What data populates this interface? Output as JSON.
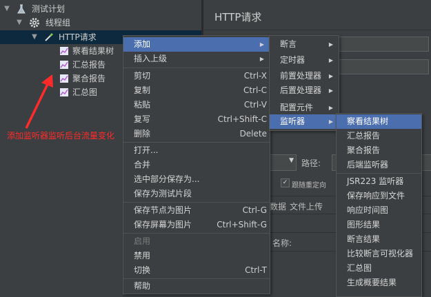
{
  "tree": {
    "items": [
      {
        "label": "测试计划"
      },
      {
        "label": "线程组"
      },
      {
        "label": "HTTP请求"
      },
      {
        "label": "察看结果树"
      },
      {
        "label": "汇总报告"
      },
      {
        "label": "聚合报告"
      },
      {
        "label": "汇总图"
      }
    ],
    "annotation": "添加监听器监听后台流量变化"
  },
  "right_panel": {
    "title": "HTTP请求",
    "path_label": "路径:",
    "follow_redirects": "跟随重定向",
    "tab_data": "数据",
    "tab_file_upload": "文件上传",
    "name_label": "名称:"
  },
  "context_menu": {
    "items": [
      {
        "label": "添加"
      },
      {
        "label": "插入上级"
      },
      {
        "label": "剪切",
        "shortcut": "Ctrl-X"
      },
      {
        "label": "复制",
        "shortcut": "Ctrl-C"
      },
      {
        "label": "粘贴",
        "shortcut": "Ctrl-V"
      },
      {
        "label": "复写",
        "shortcut": "Ctrl+Shift-C"
      },
      {
        "label": "删除",
        "shortcut": "Delete"
      },
      {
        "label": "打开..."
      },
      {
        "label": "合并"
      },
      {
        "label": "选中部分保存为..."
      },
      {
        "label": "保存为测试片段"
      },
      {
        "label": "保存节点为图片",
        "shortcut": "Ctrl-G"
      },
      {
        "label": "保存屏幕为图片",
        "shortcut": "Ctrl+Shift-G"
      },
      {
        "label": "启用"
      },
      {
        "label": "禁用"
      },
      {
        "label": "切换",
        "shortcut": "Ctrl-T"
      },
      {
        "label": "帮助"
      }
    ]
  },
  "add_submenu": {
    "items": [
      {
        "label": "断言"
      },
      {
        "label": "定时器"
      },
      {
        "label": "前置处理器"
      },
      {
        "label": "后置处理器"
      },
      {
        "label": "配置元件"
      },
      {
        "label": "监听器"
      }
    ]
  },
  "listener_submenu": {
    "items": [
      {
        "label": "察看结果树"
      },
      {
        "label": "汇总报告"
      },
      {
        "label": "聚合报告"
      },
      {
        "label": "后端监听器"
      },
      {
        "label": "JSR223 监听器"
      },
      {
        "label": "保存响应到文件"
      },
      {
        "label": "响应时间图"
      },
      {
        "label": "图形结果"
      },
      {
        "label": "断言结果"
      },
      {
        "label": "比较断言可视化器"
      },
      {
        "label": "汇总图"
      },
      {
        "label": "生成概要结果"
      }
    ]
  },
  "colors": {
    "background": "#3c3f41",
    "selection": "#4b6eaf",
    "tree_selection": "#0d293e",
    "annotation": "#ff2b2b"
  }
}
